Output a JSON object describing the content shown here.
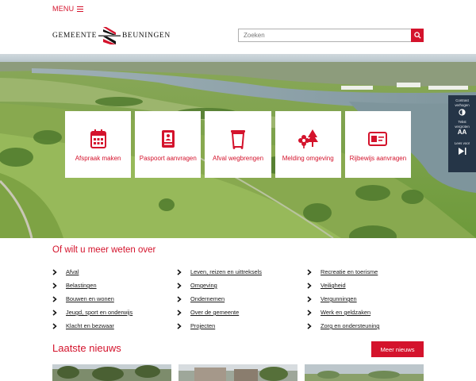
{
  "menu": {
    "label": "MENU"
  },
  "logo": {
    "word1": "GEMEENTE",
    "word2": "BEUNINGEN"
  },
  "search": {
    "placeholder": "Zoeken"
  },
  "tiles": [
    {
      "label": "Afspraak maken",
      "icon": "calendar-icon"
    },
    {
      "label": "Paspoort aanvragen",
      "icon": "passport-icon"
    },
    {
      "label": "Afval wegbrengen",
      "icon": "waste-bin-icon"
    },
    {
      "label": "Melding omgeving",
      "icon": "tree-flower-icon"
    },
    {
      "label": "Rijbewijs aanvragen",
      "icon": "id-card-icon"
    }
  ],
  "a11y": {
    "contrast": "Contrast verhogen",
    "text": "Tekst vergroten",
    "text_glyph": "AA",
    "read": "Lees voor"
  },
  "more_about": {
    "title": "Of wilt u meer weten over",
    "links": [
      "Afval",
      "Leven, reizen en uittreksels",
      "Recreatie en toerisme",
      "Belastingen",
      "Omgeving",
      "Veiligheid",
      "Bouwen en wonen",
      "Ondernemen",
      "Vergunningen",
      "Jeugd, sport en onderwijs",
      "Over de gemeente",
      "Werk en geldzaken",
      "Klacht en bezwaar",
      "Projecten",
      "Zorg en ondersteuning"
    ]
  },
  "news": {
    "title": "Laatste nieuws",
    "more_label": "Meer nieuws"
  },
  "colors": {
    "accent": "#d4132c",
    "a11y_panel": "#253547"
  }
}
